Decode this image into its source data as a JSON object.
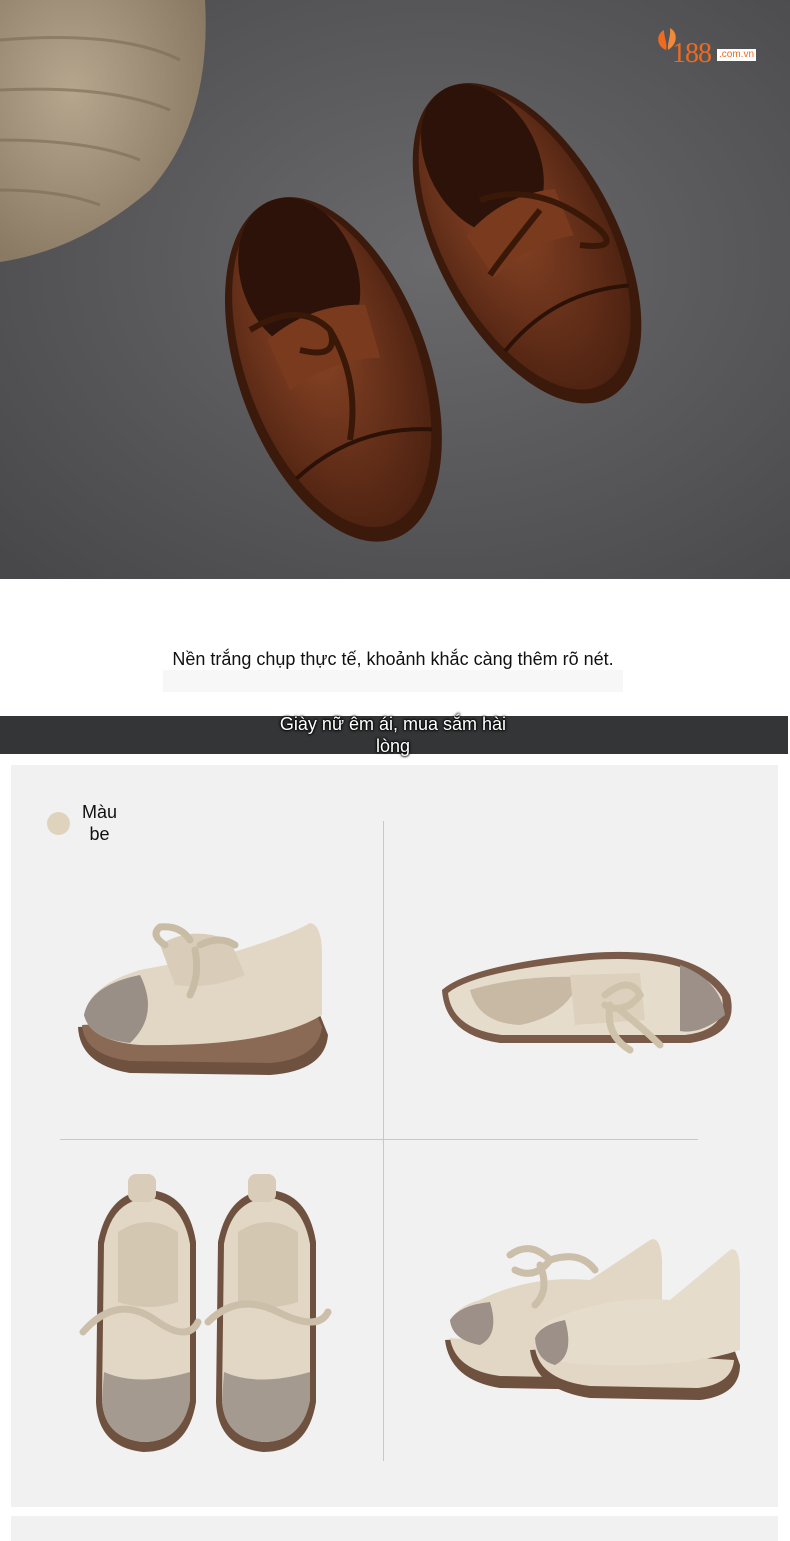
{
  "brand": {
    "logo_number": "188",
    "logo_domain": ".com.vn"
  },
  "hero": {
    "description": "Two brown leather lace-up loafers on dark grey floor next to a woven basket"
  },
  "caption": {
    "text": "Nền trắng chụp thực tế, khoảnh khắc càng thêm rõ nét."
  },
  "banner": {
    "text": "Giày nữ êm ái, mua sắm hài lòng"
  },
  "color_option": {
    "label": "Màu be",
    "swatch_color": "#e0d3bd"
  },
  "colors": {
    "banner_bg": "#343536",
    "panel_bg": "#f1f1f1",
    "brand_orange": "#ee6a1e"
  },
  "gallery": [
    {
      "icon": "shoe-side-view-image"
    },
    {
      "icon": "shoe-inner-side-view-image"
    },
    {
      "icon": "shoe-pair-top-view-image"
    },
    {
      "icon": "shoe-pair-angle-view-image"
    }
  ]
}
